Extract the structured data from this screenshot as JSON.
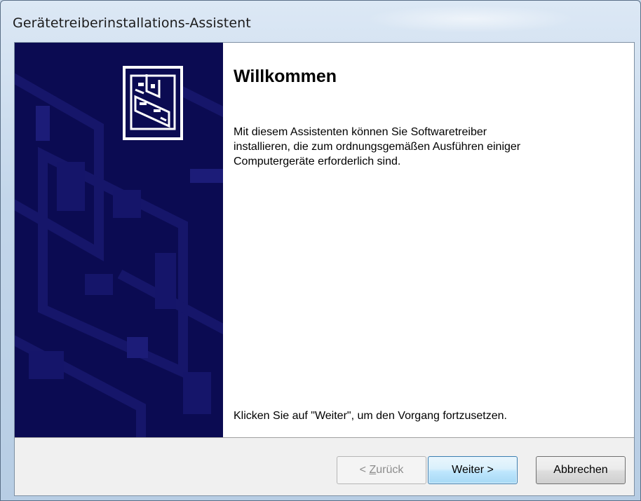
{
  "window": {
    "title": "Gerätetreiberinstallations-Assistent"
  },
  "sidebar": {
    "icon": "hardware-card-icon"
  },
  "content": {
    "heading": "Willkommen",
    "description": "Mit diesem Assistenten können Sie Softwaretreiber\ninstallieren, die zum ordnungsgemäßen Ausführen einiger\nComputergeräte erforderlich sind.",
    "instruction": "Klicken Sie auf \"Weiter\", um den Vorgang fortzusetzen."
  },
  "buttons": {
    "back": {
      "prefix": "< ",
      "mnemonic": "Z",
      "rest": "urück",
      "enabled": false
    },
    "next": {
      "label": "Weiter >",
      "enabled": true,
      "default": true
    },
    "cancel": {
      "label": "Abbrechen",
      "enabled": true
    }
  },
  "colors": {
    "sidebar_bg": "#0b0b52",
    "default_button_border": "#3c7fb1"
  }
}
